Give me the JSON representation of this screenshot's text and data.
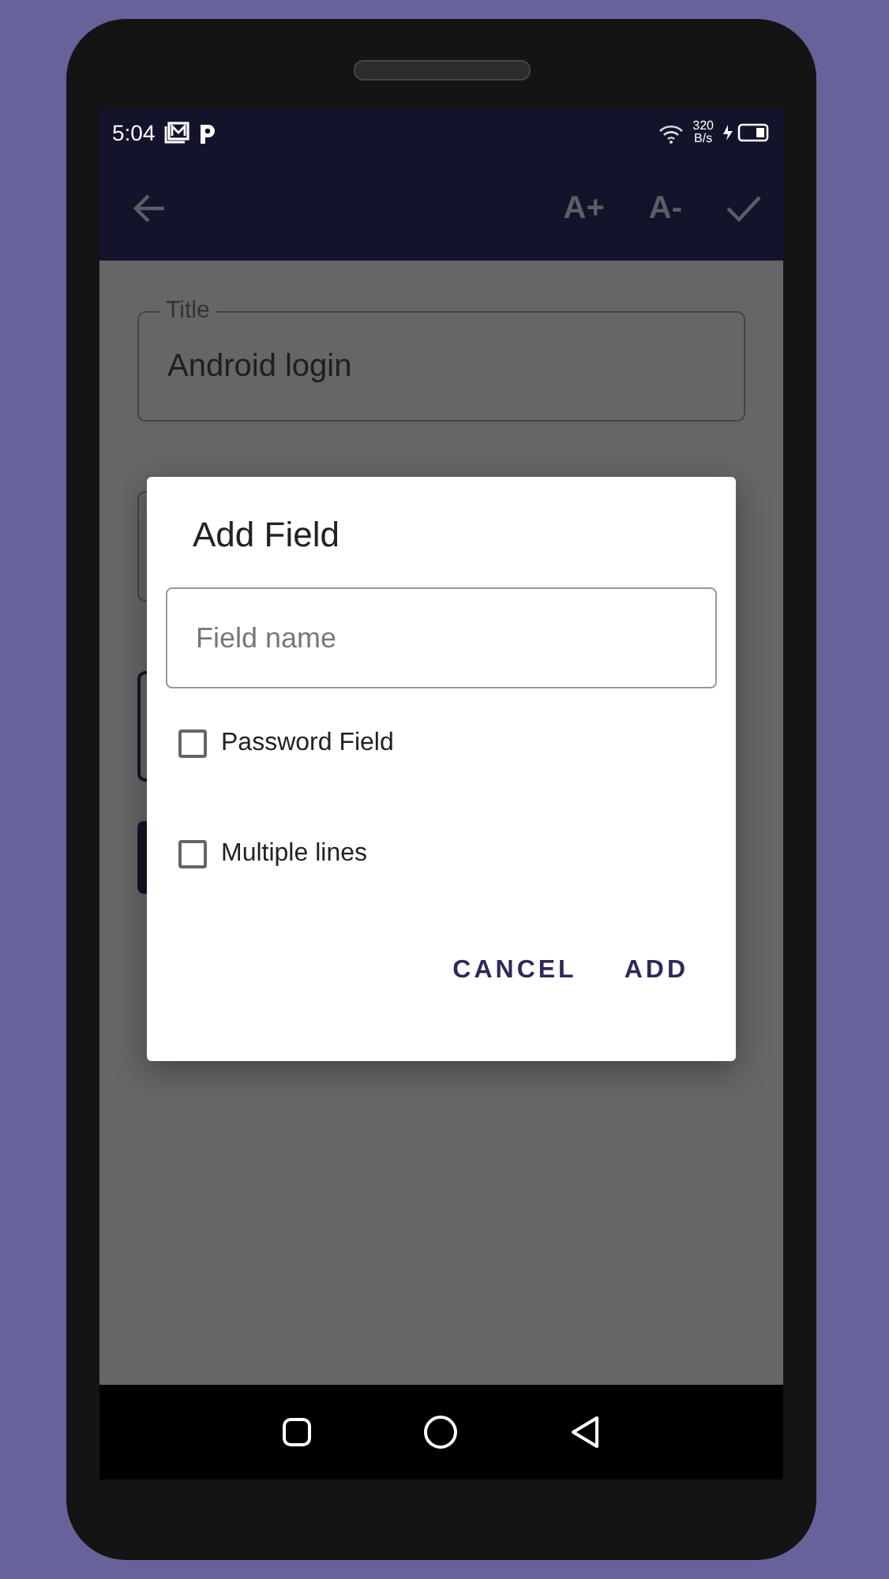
{
  "status_bar": {
    "time": "5:04",
    "speed_value": "320",
    "speed_unit": "B/s"
  },
  "app_bar": {
    "actions": [
      "A+",
      "A-"
    ]
  },
  "form": {
    "title_field": {
      "label": "Title",
      "value": "Android login"
    }
  },
  "dialog": {
    "title": "Add Field",
    "field": {
      "placeholder": "Field name"
    },
    "options": [
      {
        "label": "Password Field",
        "checked": false
      },
      {
        "label": "Multiple lines",
        "checked": false
      }
    ],
    "buttons": [
      "CANCEL",
      "ADD"
    ]
  }
}
